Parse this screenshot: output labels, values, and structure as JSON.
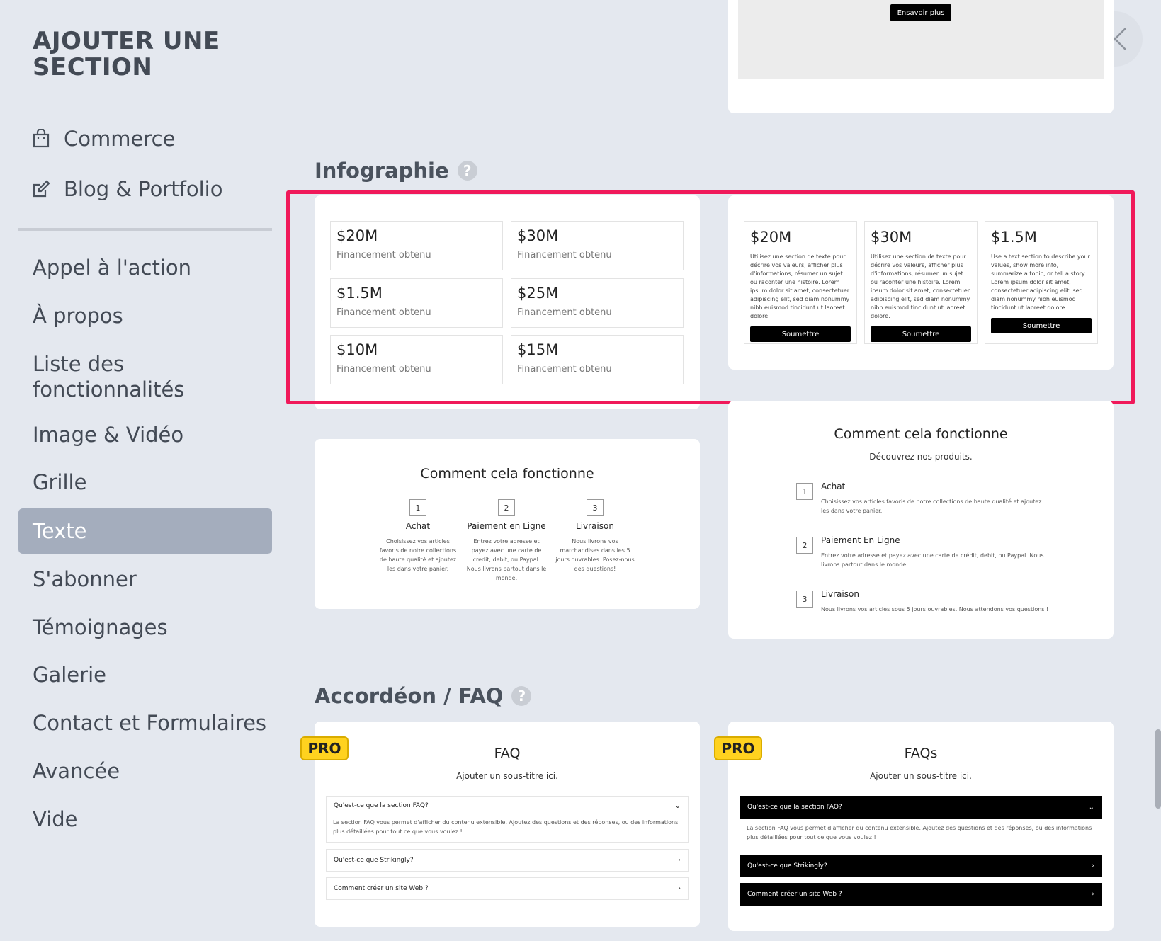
{
  "sidebar": {
    "title": "AJOUTER UNE SECTION",
    "top_items": [
      {
        "label": "Commerce",
        "icon": "shopping-bag-icon"
      },
      {
        "label": "Blog & Portfolio",
        "icon": "edit-icon"
      }
    ],
    "categories": [
      {
        "label": "Appel à l'action",
        "active": false
      },
      {
        "label": "À propos",
        "active": false
      },
      {
        "label": "Liste des fonctionnalités",
        "active": false
      },
      {
        "label": "Image & Vidéo",
        "active": false
      },
      {
        "label": "Grille",
        "active": false
      },
      {
        "label": "Texte",
        "active": true
      },
      {
        "label": "S'abonner",
        "active": false
      },
      {
        "label": "Témoignages",
        "active": false
      },
      {
        "label": "Galerie",
        "active": false
      },
      {
        "label": "Contact et Formulaires",
        "active": false
      },
      {
        "label": "Avancée",
        "active": false
      },
      {
        "label": "Vide",
        "active": false
      }
    ]
  },
  "top_card": {
    "button_label": "Ensavoir plus"
  },
  "infographie": {
    "heading": "Infographie",
    "help_icon": "?",
    "grid_card": {
      "items": [
        {
          "value": "$20M",
          "label": "Financement obtenu"
        },
        {
          "value": "$30M",
          "label": "Financement obtenu"
        },
        {
          "value": "$1.5M",
          "label": "Financement obtenu"
        },
        {
          "value": "$25M",
          "label": "Financement obtenu"
        },
        {
          "value": "$10M",
          "label": "Financement obtenu"
        },
        {
          "value": "$15M",
          "label": "Financement obtenu"
        }
      ]
    },
    "columns_card": {
      "items": [
        {
          "value": "$20M",
          "text": "Utilisez une section de texte pour décrire vos valeurs, afficher plus d'informations, résumer un sujet ou raconter une histoire. Lorem ipsum dolor sit amet, consectetuer adipiscing elit, sed diam nonummy nibh euismod tincidunt ut laoreet dolore.",
          "button": "Soumettre"
        },
        {
          "value": "$30M",
          "text": "Utilisez une section de texte pour décrire vos valeurs, afficher plus d'informations, résumer un sujet ou raconter une histoire. Lorem ipsum dolor sit amet, consectetuer adipiscing elit, sed diam nonummy nibh euismod tincidunt ut laoreet dolore.",
          "button": "Soumettre"
        },
        {
          "value": "$1.5M",
          "text": "Use a text section to describe your values, show more info, summarize a topic, or tell a story. Lorem ipsum dolor sit amet, consectetuer adipiscing elit, sed diam nonummy nibh euismod tincidunt ut laoreet dolore.",
          "button": "Soumettre"
        }
      ]
    }
  },
  "how_horizontal": {
    "title": "Comment cela fonctionne",
    "steps": [
      {
        "num": "1",
        "name": "Achat",
        "desc": "Choisissez vos articles favoris de notre collections de haute qualité et ajoutez les dans votre panier."
      },
      {
        "num": "2",
        "name": "Paiement en Ligne",
        "desc": "Entrez votre adresse et payez avec une carte de credit, debit, ou Paypal. Nous livrons partout dans le monde."
      },
      {
        "num": "3",
        "name": "Livraison",
        "desc": "Nous livrons vos marchandises dans les 5 jours ouvrables. Posez-nous des questions!"
      }
    ]
  },
  "how_vertical": {
    "title": "Comment cela fonctionne",
    "subtitle": "Découvrez nos produits.",
    "steps": [
      {
        "num": "1",
        "name": "Achat",
        "desc": "Choisissez vos articles favoris de notre collections de haute qualité et ajoutez les dans votre panier."
      },
      {
        "num": "2",
        "name": "Paiement En Ligne",
        "desc": "Entrez votre adresse et payez avec une carte de crédit, debit, ou Paypal. Nous livrons partout dans le monde."
      },
      {
        "num": "3",
        "name": "Livraison",
        "desc": "Nous livrons vos articles sous 5 jours ouvrables. Nous attendons vos questions !"
      }
    ]
  },
  "faq_section": {
    "heading": "Accordéon / FAQ",
    "help_icon": "?",
    "pro_label": "PRO",
    "card_light": {
      "title": "FAQ",
      "subtitle": "Ajouter un sous-titre ici.",
      "q1": "Qu'est-ce que la section FAQ?",
      "a1": "La section FAQ vous permet d'afficher du contenu extensible. Ajoutez des questions et des réponses, ou des informations plus détaillées pour tout ce que vous voulez !",
      "q2": "Qu'est-ce que Strikingly?",
      "q3": "Comment créer un site Web ?"
    },
    "card_dark": {
      "title": "FAQs",
      "subtitle": "Ajouter un sous-titre ici.",
      "q1": "Qu'est-ce que la section FAQ?",
      "a1": "La section FAQ vous permet d'afficher du contenu extensible. Ajoutez des questions et des réponses, ou des informations plus détaillées pour tout ce que vous voulez !",
      "q2": "Qu'est-ce que Strikingly?",
      "q3": "Comment créer un site Web ?"
    }
  },
  "colors": {
    "accent_highlight": "#f0195a",
    "active_item": "#a4adbd",
    "pro_badge": "#ffd21f"
  }
}
